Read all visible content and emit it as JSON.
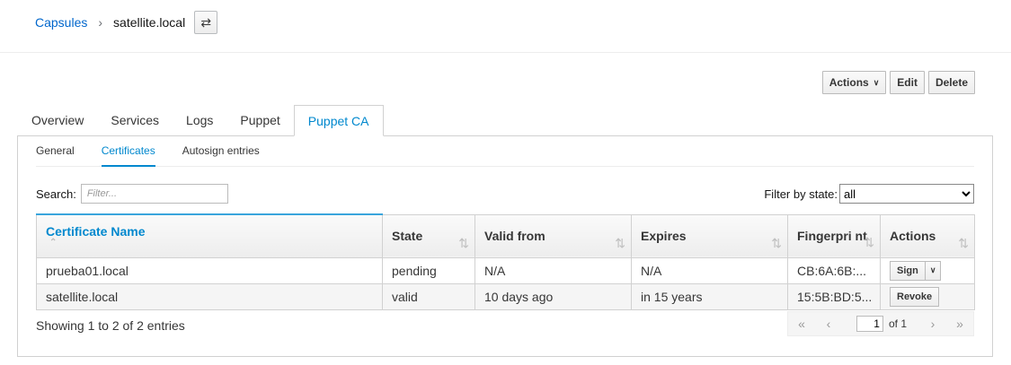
{
  "breadcrumb": {
    "parent": "Capsules",
    "current": "satellite.local"
  },
  "header_buttons": {
    "actions": "Actions",
    "edit": "Edit",
    "delete": "Delete"
  },
  "tabs": [
    "Overview",
    "Services",
    "Logs",
    "Puppet",
    "Puppet CA"
  ],
  "subtabs": [
    "General",
    "Certificates",
    "Autosign entries"
  ],
  "search": {
    "label": "Search:",
    "placeholder": "Filter..."
  },
  "filter": {
    "label": "Filter by state:",
    "selected": "all"
  },
  "table": {
    "headers": [
      "Certificate Name",
      "State",
      "Valid from",
      "Expires",
      "Fingerpri nt",
      "Actions"
    ],
    "rows": [
      {
        "name": "prueba01.local",
        "state": "pending",
        "valid_from": "N/A",
        "expires": "N/A",
        "fingerprint": "CB:6A:6B:...",
        "action": "Sign"
      },
      {
        "name": "satellite.local",
        "state": "valid",
        "valid_from": "10 days ago",
        "expires": "in 15 years",
        "fingerprint": "15:5B:BD:5...",
        "action": "Revoke"
      }
    ]
  },
  "footer": {
    "showing": "Showing 1 to 2 of 2 entries"
  },
  "pager": {
    "page": "1",
    "of": "of 1"
  }
}
